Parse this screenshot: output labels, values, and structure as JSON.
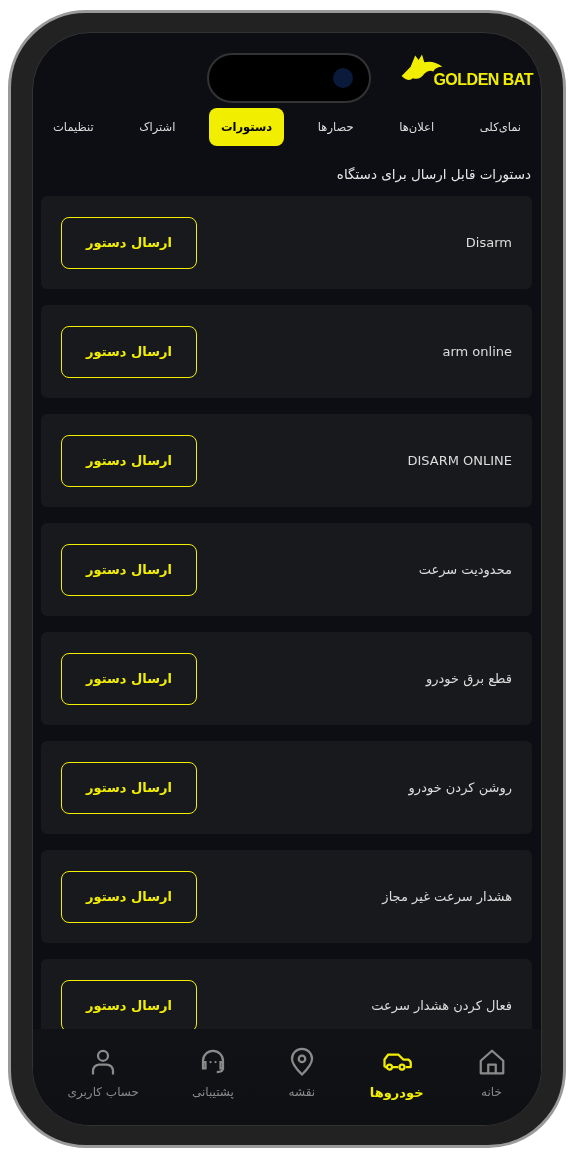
{
  "brand": {
    "logo": "GOLDEN BAT"
  },
  "tabs": [
    {
      "label": "نمای‌کلی",
      "selected": false
    },
    {
      "label": "اعلان‌ها",
      "selected": false
    },
    {
      "label": "حصارها",
      "selected": false
    },
    {
      "label": "دستورات",
      "selected": true
    },
    {
      "label": "اشتراک",
      "selected": false
    },
    {
      "label": "تنظیمات",
      "selected": false
    }
  ],
  "heading": "دستورات قابل ارسال برای دستگاه",
  "commands": [
    {
      "name": "Disarm",
      "button": "ارسال دستور"
    },
    {
      "name": "arm online",
      "button": "ارسال دستور"
    },
    {
      "name": "DISARM ONLINE",
      "button": "ارسال دستور"
    },
    {
      "name": "محدودیت سرعت",
      "button": "ارسال دستور"
    },
    {
      "name": "قطع برق خودرو",
      "button": "ارسال دستور"
    },
    {
      "name": "روشن کردن خودرو",
      "button": "ارسال دستور"
    },
    {
      "name": "هشدار سرعت غیر مجاز",
      "button": "ارسال دستور"
    },
    {
      "name": "فعال کردن هشدار سرعت",
      "button": "ارسال دستور"
    }
  ],
  "bottom_nav": [
    {
      "label": "خانه",
      "selected": false
    },
    {
      "label": "خودروها",
      "selected": true
    },
    {
      "label": "نقشه",
      "selected": false
    },
    {
      "label": "پشتیبانی",
      "selected": false
    },
    {
      "label": "حساب کاربری",
      "selected": false
    }
  ]
}
